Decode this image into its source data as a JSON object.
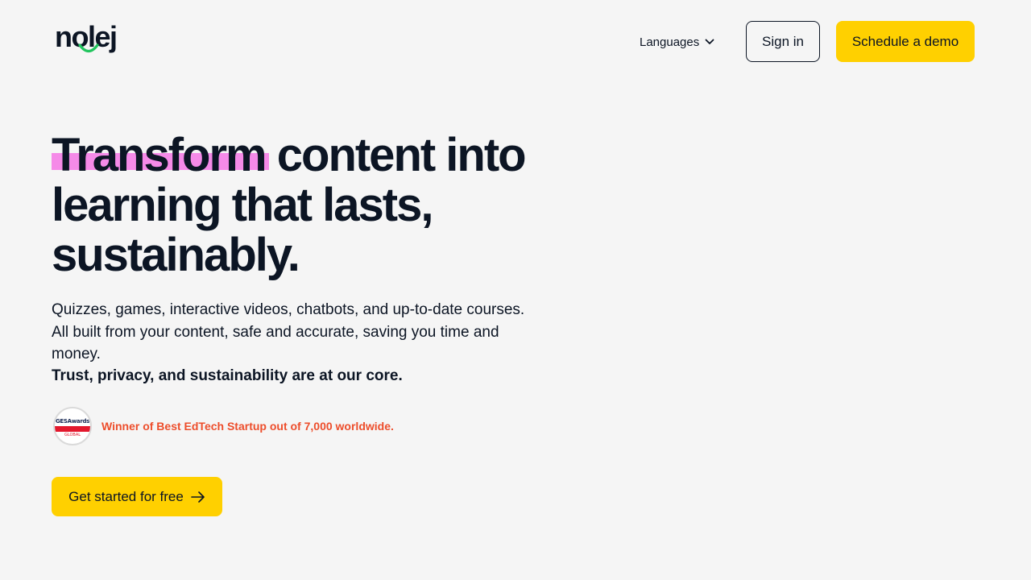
{
  "header": {
    "logo_text": "nolej",
    "languages_label": "Languages",
    "signin_label": "Sign in",
    "demo_label": "Schedule a demo"
  },
  "hero": {
    "title_highlight": "Transform",
    "title_rest": " content into learning that lasts, sustainably.",
    "subtitle": "Quizzes, games, interactive videos, chatbots, and up-to-date courses. All built from your content, safe and accurate, saving you time and money.",
    "strong_line": "Trust, privacy, and sustainability are at our core."
  },
  "award": {
    "badge_top": "GESAwards",
    "badge_bottom": "GLOBAL",
    "text": "Winner of Best EdTech Startup out of 7,000 worldwide."
  },
  "cta": {
    "label": "Get started for free"
  },
  "icons": {
    "languages": "chevron-down-icon",
    "cta": "arrow-right-icon",
    "logo_mark": "smile-icon"
  },
  "colors": {
    "background": "#f5f5f5",
    "text": "#0c1524",
    "accent_yellow": "#ffd000",
    "highlight_pink": "#f58ae8",
    "logo_green": "#22c55e",
    "award_red": "#ed4e2c"
  }
}
